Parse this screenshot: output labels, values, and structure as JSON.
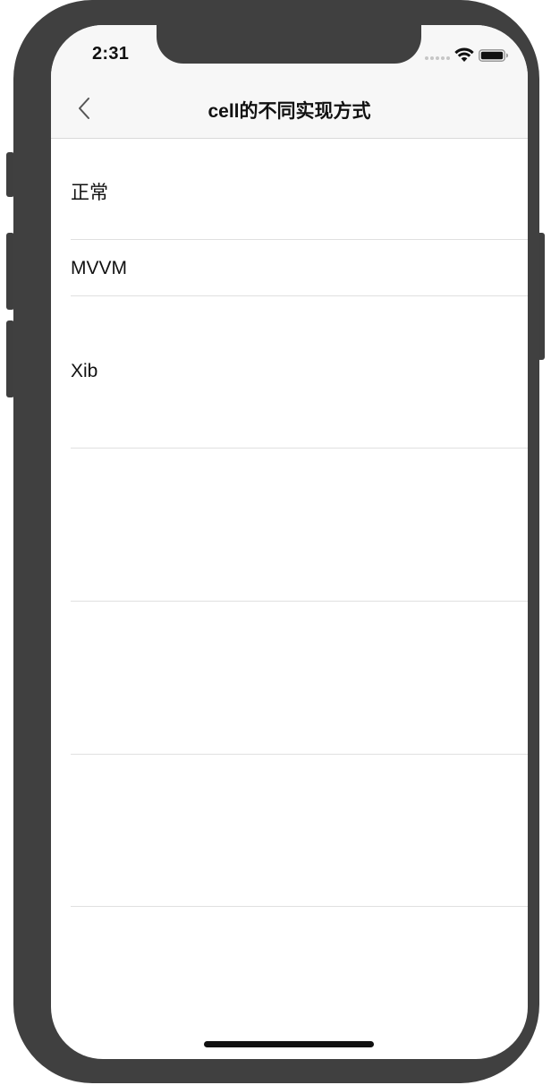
{
  "status_bar": {
    "time": "2:31"
  },
  "nav": {
    "back_icon": "chevron-left-icon",
    "title": "cell的不同实现方式"
  },
  "list": {
    "rows": [
      {
        "label": "正常"
      },
      {
        "label": "MVVM"
      },
      {
        "label": "Xib"
      },
      {
        "label": ""
      },
      {
        "label": ""
      },
      {
        "label": ""
      }
    ]
  },
  "colors": {
    "frame": "#404040",
    "nav_background": "#f7f7f7",
    "separator": "#e0e0e0",
    "text": "#111111"
  }
}
